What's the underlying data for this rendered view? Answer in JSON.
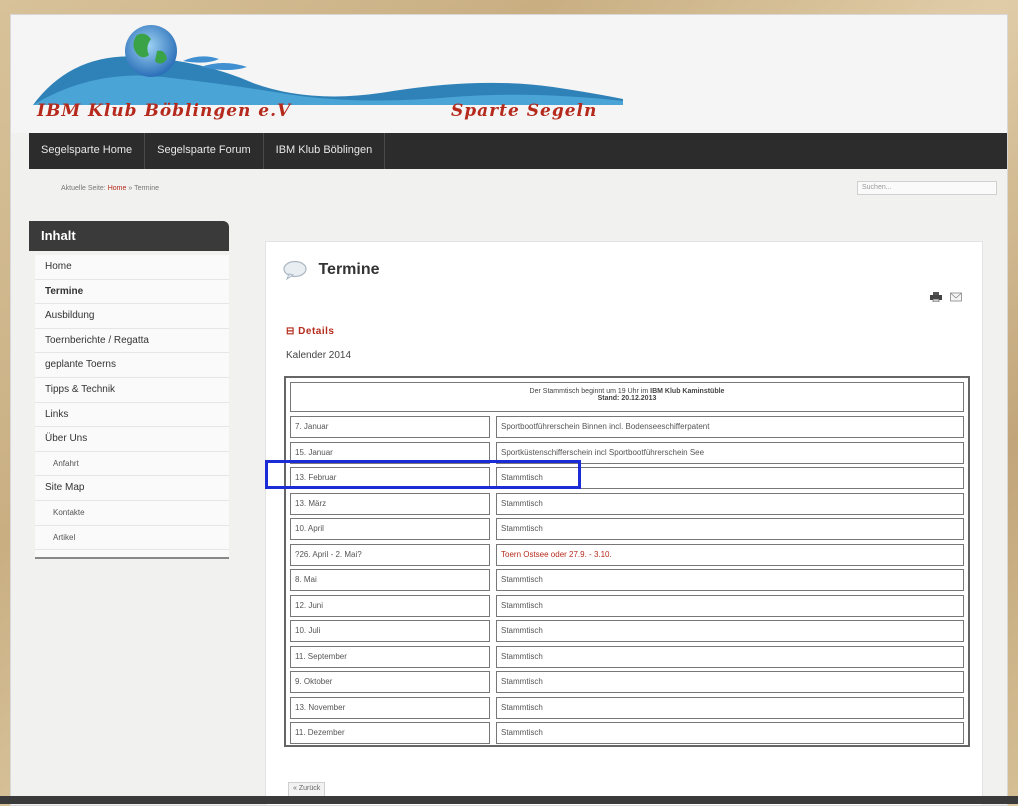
{
  "header": {
    "site_title": "IBM Klub Böblingen e.V",
    "site_subtitle": "Sparte Segeln"
  },
  "nav": {
    "items": [
      "Segelsparte Home",
      "Segelsparte Forum",
      "IBM Klub Böblingen"
    ]
  },
  "breadcrumb": {
    "prefix": "Aktuelle Seite:",
    "home": "Home",
    "separator": "»",
    "current": "Termine"
  },
  "search": {
    "placeholder": "Suchen..."
  },
  "sidebar": {
    "title": "Inhalt",
    "items": [
      {
        "label": "Home"
      },
      {
        "label": "Termine"
      },
      {
        "label": "Ausbildung"
      },
      {
        "label": "Toernberichte / Regatta"
      },
      {
        "label": "geplante Toerns"
      },
      {
        "label": "Tipps & Technik"
      },
      {
        "label": "Links"
      },
      {
        "label": "Über Uns"
      },
      {
        "label": "Anfahrt"
      },
      {
        "label": "Site Map"
      },
      {
        "label": "Kontakte"
      },
      {
        "label": "Artikel"
      }
    ]
  },
  "main": {
    "title": "Termine",
    "details_label": "Details",
    "calendar_title": "Kalender 2014",
    "header_line1_pre": "Der Stammtisch beginnt um 19 Uhr im",
    "header_line1_bold": "IBM Klub Kaminstüble",
    "header_line2": "Stand: 20.12.2013",
    "rows": [
      {
        "date": "7. Januar",
        "event": "Sportbootführerschein Binnen incl. Bodenseeschifferpatent"
      },
      {
        "date": "15. Januar",
        "event": "Sportküstenschifferschein incl Sportbootführerschein See"
      },
      {
        "date": "13. Februar",
        "event": "Stammtisch"
      },
      {
        "date": "13. März",
        "event": "Stammtisch"
      },
      {
        "date": "10. April",
        "event": "Stammtisch"
      },
      {
        "date": "?26. April - 2. Mai?",
        "event": "Toern Ostsee oder 27.9. - 3.10."
      },
      {
        "date": "8. Mai",
        "event": "Stammtisch"
      },
      {
        "date": "12. Juni",
        "event": "Stammtisch"
      },
      {
        "date": "10. Juli",
        "event": "Stammtisch"
      },
      {
        "date": "11. September",
        "event": "Stammtisch"
      },
      {
        "date": "9. Oktober",
        "event": "Stammtisch"
      },
      {
        "date": "13. November",
        "event": "Stammtisch"
      },
      {
        "date": "11. Dezember",
        "event": "Stammtisch"
      }
    ],
    "back_label": "« Zurück"
  },
  "colors": {
    "accent": "#b52a1c",
    "nav_bg": "#2c2c2c",
    "highlight": "#1b2cd6"
  }
}
